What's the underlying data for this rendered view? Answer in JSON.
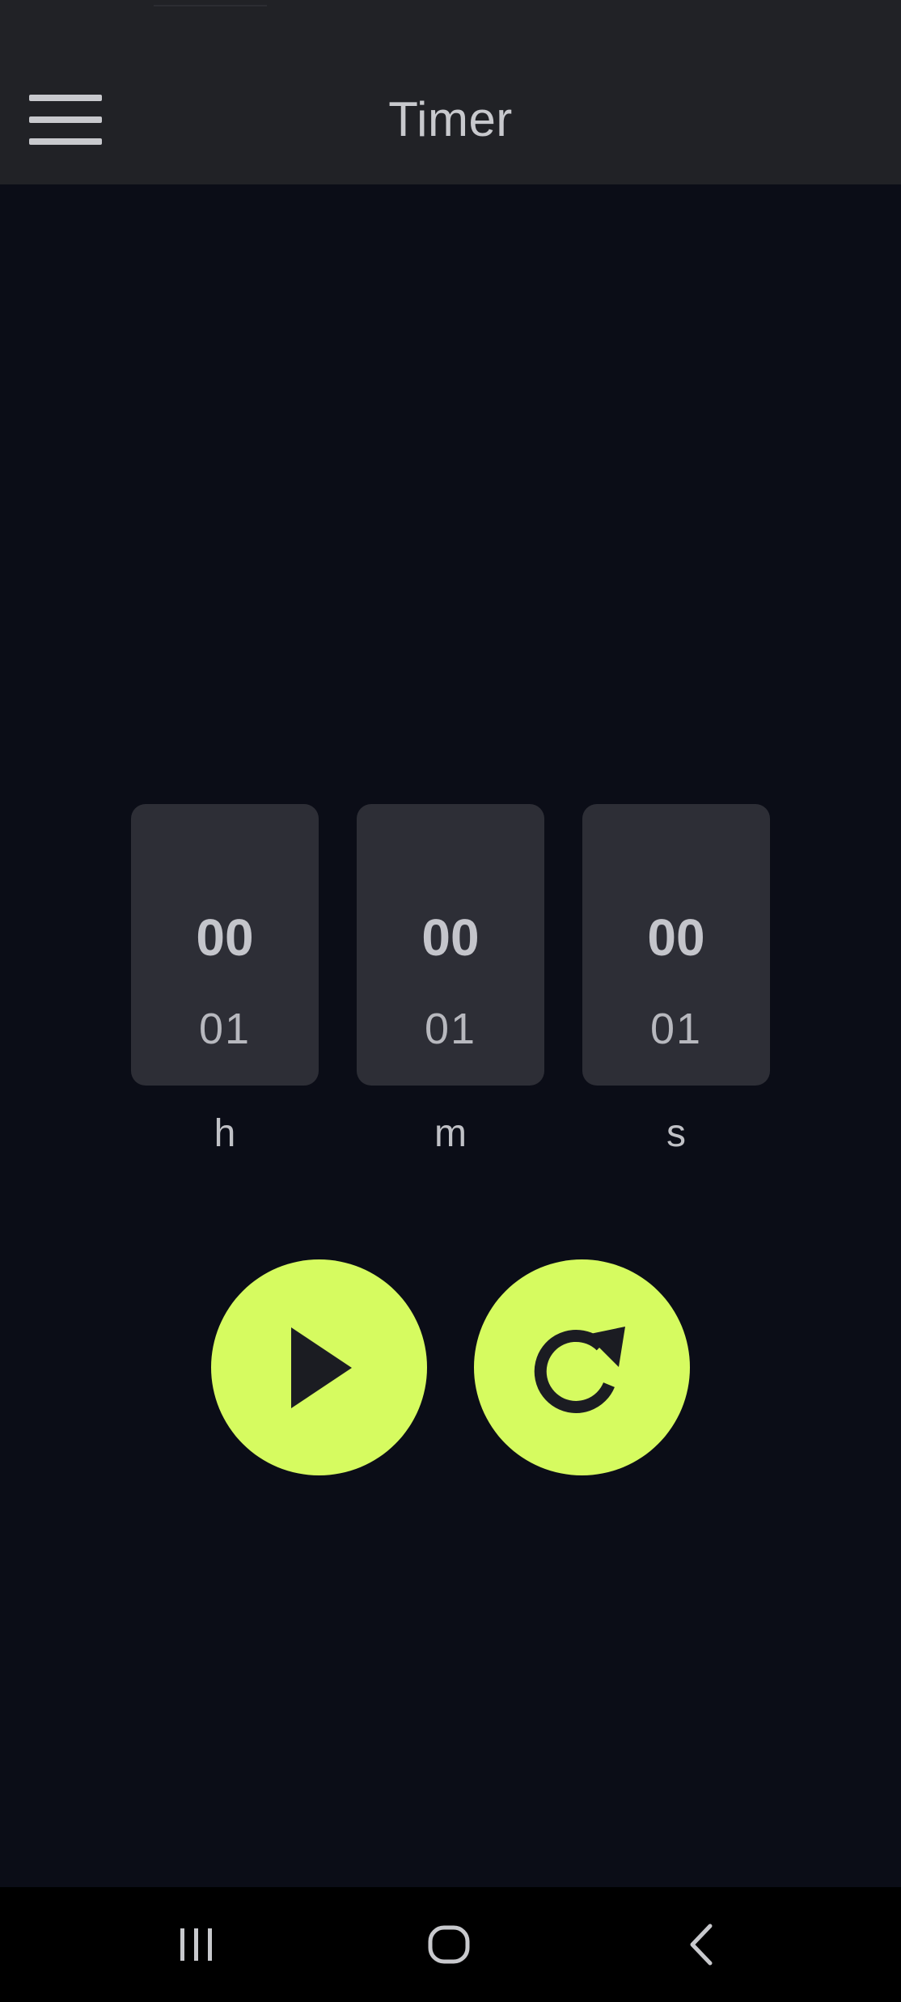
{
  "app_bar": {
    "title": "Timer",
    "menu_icon": "hamburger-menu-icon"
  },
  "pickers": [
    {
      "id": "hours",
      "current": "00",
      "next": "01",
      "unit": "h"
    },
    {
      "id": "minutes",
      "current": "00",
      "next": "01",
      "unit": "m"
    },
    {
      "id": "seconds",
      "current": "00",
      "next": "01",
      "unit": "s"
    }
  ],
  "actions": {
    "start_icon": "play-icon",
    "reset_icon": "reset-icon"
  },
  "nav_bar": {
    "recents_icon": "recents-icon",
    "home_icon": "home-icon",
    "back_icon": "back-icon"
  },
  "colors": {
    "background": "#0b0d17",
    "app_bar": "#212226",
    "picker_card": "#2d2e36",
    "accent": "#d6fb60",
    "icon_dark": "#1b1c22"
  }
}
